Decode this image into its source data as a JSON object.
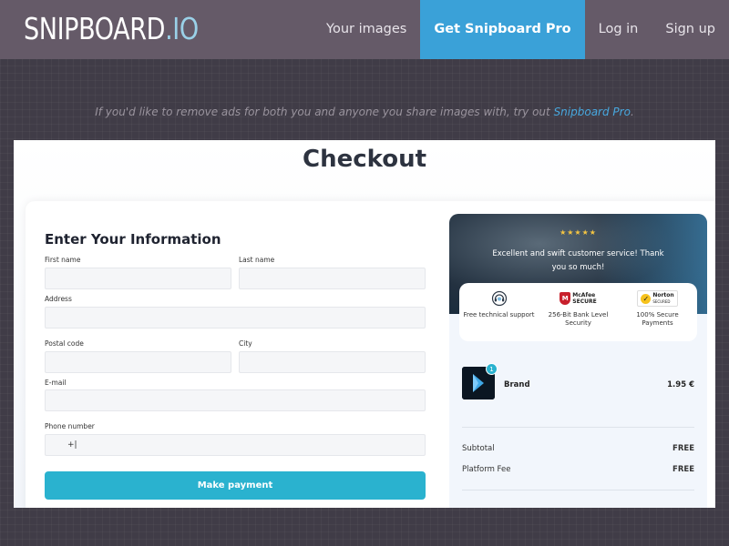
{
  "nav": {
    "logo_main": "SNIPBOARD",
    "logo_tld": ".IO",
    "links": [
      "Your images",
      "Get Snipboard Pro",
      "Log in",
      "Sign up"
    ]
  },
  "promo": {
    "text": "If you'd like to remove ads for both you and anyone you share images with, try out ",
    "link": "Snipboard Pro",
    "end": "."
  },
  "checkout": {
    "title": "Checkout",
    "form": {
      "heading": "Enter Your Information",
      "first_name_label": "First name",
      "last_name_label": "Last name",
      "address_label": "Address",
      "postal_label": "Postal code",
      "city_label": "City",
      "email_label": "E-mail",
      "phone_label": "Phone number",
      "phone_value": "+|",
      "submit": "Make payment"
    },
    "review": {
      "stars": "★★★★★",
      "text": "Excellent and swift customer service! Thank you so much!"
    },
    "trust": [
      {
        "icon": "headset-icon",
        "label": "Free technical support"
      },
      {
        "icon": "mcafee-secure-icon",
        "label": "256-Bit Bank Level Security",
        "badge_top": "McAfee",
        "badge_bottom": "SECURE"
      },
      {
        "icon": "norton-secured-icon",
        "label": "100% Secure Payments",
        "badge_top": "Norton",
        "badge_bottom": "SECURED"
      }
    ],
    "product": {
      "qty": "1",
      "name": "Brand",
      "price": "1.95 €"
    },
    "summary": [
      {
        "label": "Subtotal",
        "value": "FREE"
      },
      {
        "label": "Platform Fee",
        "value": "FREE"
      }
    ]
  },
  "colors": {
    "nav_bg": "#655a68",
    "pro_bg": "#3aa1d8",
    "accent": "#2ab2cf",
    "page_bg": "#403c47"
  }
}
